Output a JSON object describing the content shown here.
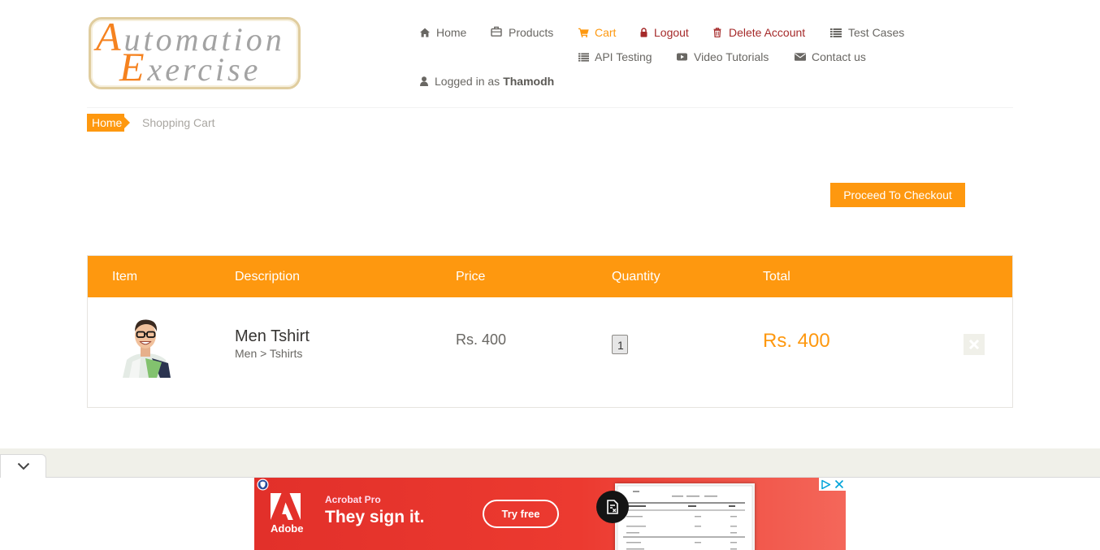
{
  "colors": {
    "accent": "#FE980F",
    "text": "#696763",
    "heading": "#363432",
    "danger_link": "#A52A2A",
    "table_border": "#E6E4DF",
    "footer_band": "#F0F0E9",
    "ad_background": "#E8352B"
  },
  "logo": {
    "line1": "Automation",
    "line2": "Exercise"
  },
  "nav": {
    "items": [
      {
        "label": "Home",
        "icon": "home-icon"
      },
      {
        "label": "Products",
        "icon": "products-icon"
      },
      {
        "label": "Cart",
        "icon": "cart-icon",
        "active": true
      },
      {
        "label": "Logout",
        "icon": "lock-icon"
      },
      {
        "label": "Delete Account",
        "icon": "trash-icon"
      },
      {
        "label": "Test Cases",
        "icon": "list-icon"
      },
      {
        "label": "API Testing",
        "icon": "list-icon"
      },
      {
        "label": "Video Tutorials",
        "icon": "youtube-icon"
      },
      {
        "label": "Contact us",
        "icon": "envelope-icon"
      }
    ],
    "logged_in": {
      "prefix": "Logged in as",
      "username": "Thamodh",
      "icon": "user-icon"
    }
  },
  "breadcrumb": {
    "items": [
      "Home",
      "Shopping Cart"
    ]
  },
  "cart": {
    "checkout_label": "Proceed To Checkout",
    "columns": [
      "Item",
      "Description",
      "Price",
      "Quantity",
      "Total"
    ],
    "items": [
      {
        "name": "Men Tshirt",
        "category": "Men > Tshirts",
        "price": "Rs. 400",
        "quantity": 1,
        "total": "Rs. 400",
        "delete_icon": "close-icon"
      }
    ]
  },
  "ad": {
    "brand": "Adobe",
    "product": "Acrobat Pro",
    "headline": "They sign it.",
    "cta": "Try free",
    "icons": {
      "privacy": "shield-icon",
      "brand_logo": "adobe-logo-icon",
      "feature": "document-icon",
      "adchoices": "adchoices-icon",
      "close": "close-icon"
    }
  },
  "ad_toggle": {
    "icon": "chevron-down-icon"
  }
}
